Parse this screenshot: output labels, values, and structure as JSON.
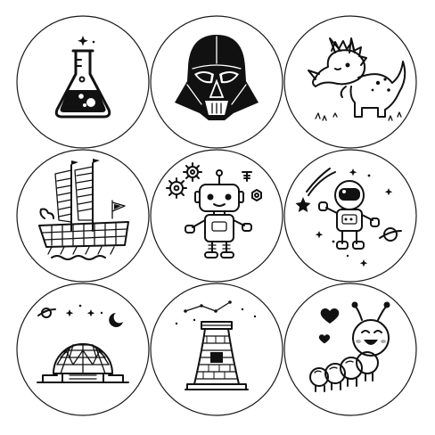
{
  "sheet": {
    "title": "",
    "background": "#ffffff",
    "ink": "#111111"
  },
  "stickers": [
    {
      "name": "lab-flask",
      "icon": "flask-icon"
    },
    {
      "name": "darth-vader-helmet",
      "icon": "helmet-icon"
    },
    {
      "name": "triceratops-dinosaur",
      "icon": "dinosaur-icon"
    },
    {
      "name": "turtle-ship",
      "icon": "ship-icon"
    },
    {
      "name": "robot-with-gears",
      "icon": "robot-icon"
    },
    {
      "name": "astronaut-in-space",
      "icon": "astronaut-icon"
    },
    {
      "name": "geodesic-dome-science-center",
      "icon": "dome-icon"
    },
    {
      "name": "cheomseongdae-observatory",
      "icon": "observatory-icon"
    },
    {
      "name": "smiling-caterpillar",
      "icon": "caterpillar-icon"
    }
  ]
}
